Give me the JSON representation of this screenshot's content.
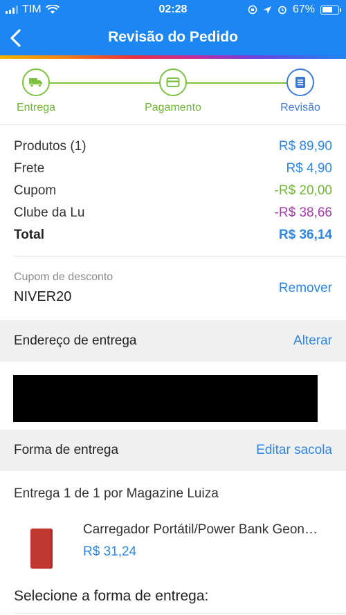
{
  "status_bar": {
    "carrier": "TIM",
    "time": "02:28",
    "battery": "67%",
    "battery_level": 0.67
  },
  "header": {
    "title": "Revisão do Pedido"
  },
  "stepper": {
    "steps": [
      {
        "label": "Entrega",
        "icon": "truck-icon",
        "state": "done"
      },
      {
        "label": "Pagamento",
        "icon": "credit-card-icon",
        "state": "done"
      },
      {
        "label": "Revisão",
        "icon": "document-icon",
        "state": "current"
      }
    ]
  },
  "summary": {
    "rows": [
      {
        "label": "Produtos (1)",
        "value": "R$ 89,90",
        "color": "#2f86e0"
      },
      {
        "label": "Frete",
        "value": "R$ 4,90",
        "color": "#2f86e0"
      },
      {
        "label": "Cupom",
        "value": "-R$ 20,00",
        "color": "#72b63a"
      },
      {
        "label": "Clube da Lu",
        "value": "-R$ 38,66",
        "color": "#9d3ea4"
      }
    ],
    "total_label": "Total",
    "total_value": "R$ 36,14"
  },
  "coupon": {
    "label": "Cupom de desconto",
    "code": "NIVER20",
    "remove_label": "Remover"
  },
  "address_section": {
    "title": "Endereço de entrega",
    "action": "Alterar"
  },
  "shipping_section": {
    "title": "Forma de entrega",
    "action": "Editar sacola"
  },
  "delivery": {
    "count": "Entrega 1 de 1",
    "seller": "por Magazine Luiza"
  },
  "product": {
    "name": "Carregador Portátil/Power Bank Geon…",
    "price": "R$ 31,24"
  },
  "select_title": "Selecione a forma de entrega:",
  "colors": {
    "header_blue": "#1c86f2",
    "step_green": "#7cc241",
    "link_blue": "#2f86e0",
    "coupon_green": "#72b63a",
    "club_purple": "#9d3ea4"
  }
}
